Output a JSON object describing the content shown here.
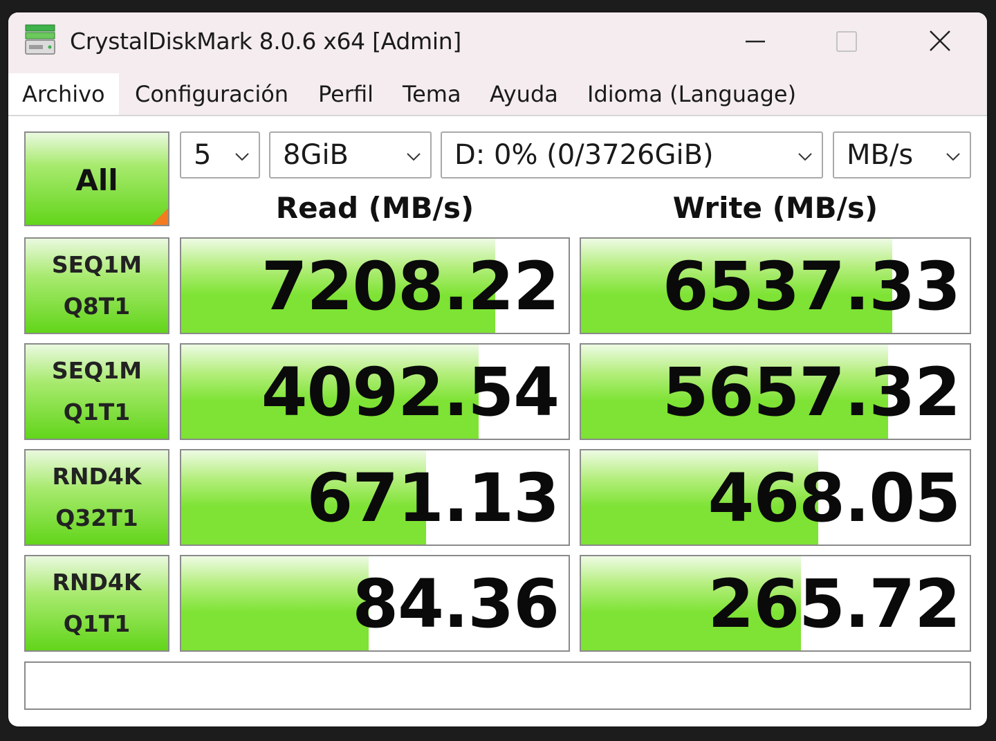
{
  "window": {
    "title": "CrystalDiskMark 8.0.6 x64 [Admin]"
  },
  "menu": [
    {
      "label": "Archivo"
    },
    {
      "label": "Configuración"
    },
    {
      "label": "Perfil"
    },
    {
      "label": "Tema"
    },
    {
      "label": "Ayuda"
    },
    {
      "label": "Idioma (Language)"
    }
  ],
  "controls": {
    "all_label": "All",
    "count": "5",
    "size": "8GiB",
    "drive": "D: 0% (0/3726GiB)",
    "unit": "MB/s"
  },
  "headers": {
    "read": "Read (MB/s)",
    "write": "Write (MB/s)"
  },
  "tests": [
    {
      "line1": "SEQ1M",
      "line2": "Q8T1",
      "read": "7208.22",
      "write": "6537.33",
      "read_fill": 0.81,
      "write_fill": 0.8
    },
    {
      "line1": "SEQ1M",
      "line2": "Q1T1",
      "read": "4092.54",
      "write": "5657.32",
      "read_fill": 0.768,
      "write_fill": 0.79
    },
    {
      "line1": "RND4K",
      "line2": "Q32T1",
      "read": "671.13",
      "write": "468.05",
      "read_fill": 0.633,
      "write_fill": 0.61
    },
    {
      "line1": "RND4K",
      "line2": "Q1T1",
      "read": "84.36",
      "write": "265.72",
      "read_fill": 0.484,
      "write_fill": 0.565
    }
  ],
  "comment": "",
  "colors": {
    "titlebar": "#f4ecef",
    "bar_green": "#7ee334",
    "button_green": "#62d51a",
    "corner_orange": "#f47b20"
  },
  "icons": {
    "app": "drive-stack-icon",
    "minimize": "minimize-icon",
    "maximize": "maximize-icon",
    "close": "close-icon",
    "dropdown": "chevron-down-icon"
  }
}
